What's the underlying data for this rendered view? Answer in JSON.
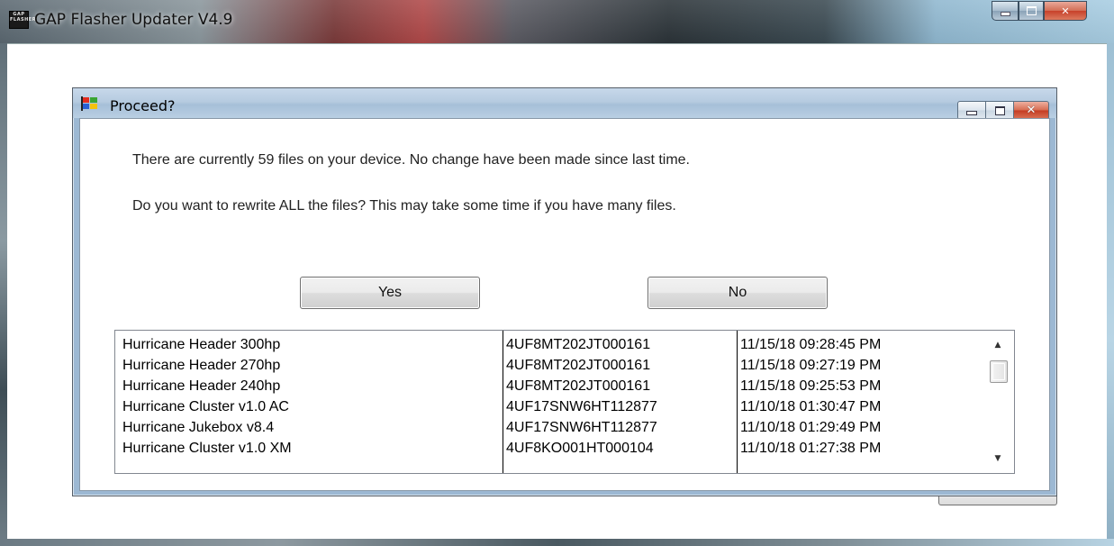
{
  "outer_window": {
    "title": "GAP Flasher Updater V4.9",
    "icon_text": [
      "GAP",
      "FLASHER"
    ]
  },
  "dialog": {
    "title": "Proceed?",
    "message_line1": "There are currently 59 files on your device. No change have been made since last time.",
    "message_line2": "Do you want to rewrite ALL the files? This may take some time if you have many files.",
    "yes_label": "Yes",
    "no_label": "No"
  },
  "file_list": {
    "rows": [
      [
        "Hurricane Header 300hp",
        "4UF8MT202JT000161",
        "11/15/18 09:28:45 PM"
      ],
      [
        "Hurricane Header 270hp",
        "4UF8MT202JT000161",
        "11/15/18 09:27:19 PM"
      ],
      [
        "Hurricane Header 240hp",
        "4UF8MT202JT000161",
        "11/15/18 09:25:53 PM"
      ],
      [
        "Hurricane Cluster v1.0 AC",
        "4UF17SNW6HT112877",
        "11/10/18 01:30:47 PM"
      ],
      [
        "Hurricane Jukebox v8.4",
        "4UF17SNW6HT112877",
        "11/10/18 01:29:49 PM"
      ],
      [
        "Hurricane Cluster v1.0 XM",
        "4UF8KO001HT000104",
        "11/10/18 01:27:38 PM"
      ]
    ]
  },
  "icons": {
    "app": "gap-flasher-icon",
    "dialog": "colorful-flag-icon",
    "scroll_up": "arrow-up-icon",
    "scroll_down": "arrow-down-icon"
  },
  "colors": {
    "dialog_frame": "#9cb8d3",
    "close_button": "#c43b22"
  }
}
